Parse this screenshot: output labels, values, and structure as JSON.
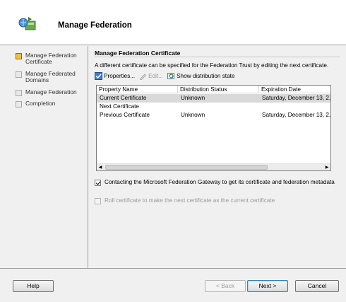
{
  "header": {
    "title": "Manage Federation"
  },
  "nav": {
    "items": [
      {
        "label": "Manage Federation Certificate",
        "active": true
      },
      {
        "label": "Manage Federated Domains",
        "active": false
      },
      {
        "label": "Manage Federation",
        "active": false
      },
      {
        "label": "Completion",
        "active": false
      }
    ]
  },
  "section": {
    "title": "Manage Federation Certificate",
    "description": "A different certificate can be specified for the Federation Trust by editing the next certificate."
  },
  "toolbar": {
    "properties_label": "Properties...",
    "edit_label": "Edit...",
    "show_state_label": "Show distribution state"
  },
  "list": {
    "columns": [
      "Property Name",
      "Distribution Status",
      "Expiration Date"
    ],
    "rows": [
      [
        "Current Certificate",
        "Unknown",
        "Saturday, December 13, 2..."
      ],
      [
        "Next Certificate",
        "",
        ""
      ],
      [
        "Previous Certificate",
        "Unknown",
        "Saturday, December 13, 2..."
      ]
    ],
    "selected_row": 0
  },
  "options": {
    "gateway_label": "Contacting the Microsoft Federation Gateway to get its certificate and federation metadata",
    "gateway_checked": true,
    "roll_label": "Roll certificate to make the next certificate as the current certificate",
    "roll_checked": false
  },
  "buttons": {
    "help": "Help",
    "back": "< Back",
    "next": "Next >",
    "cancel": "Cancel"
  }
}
